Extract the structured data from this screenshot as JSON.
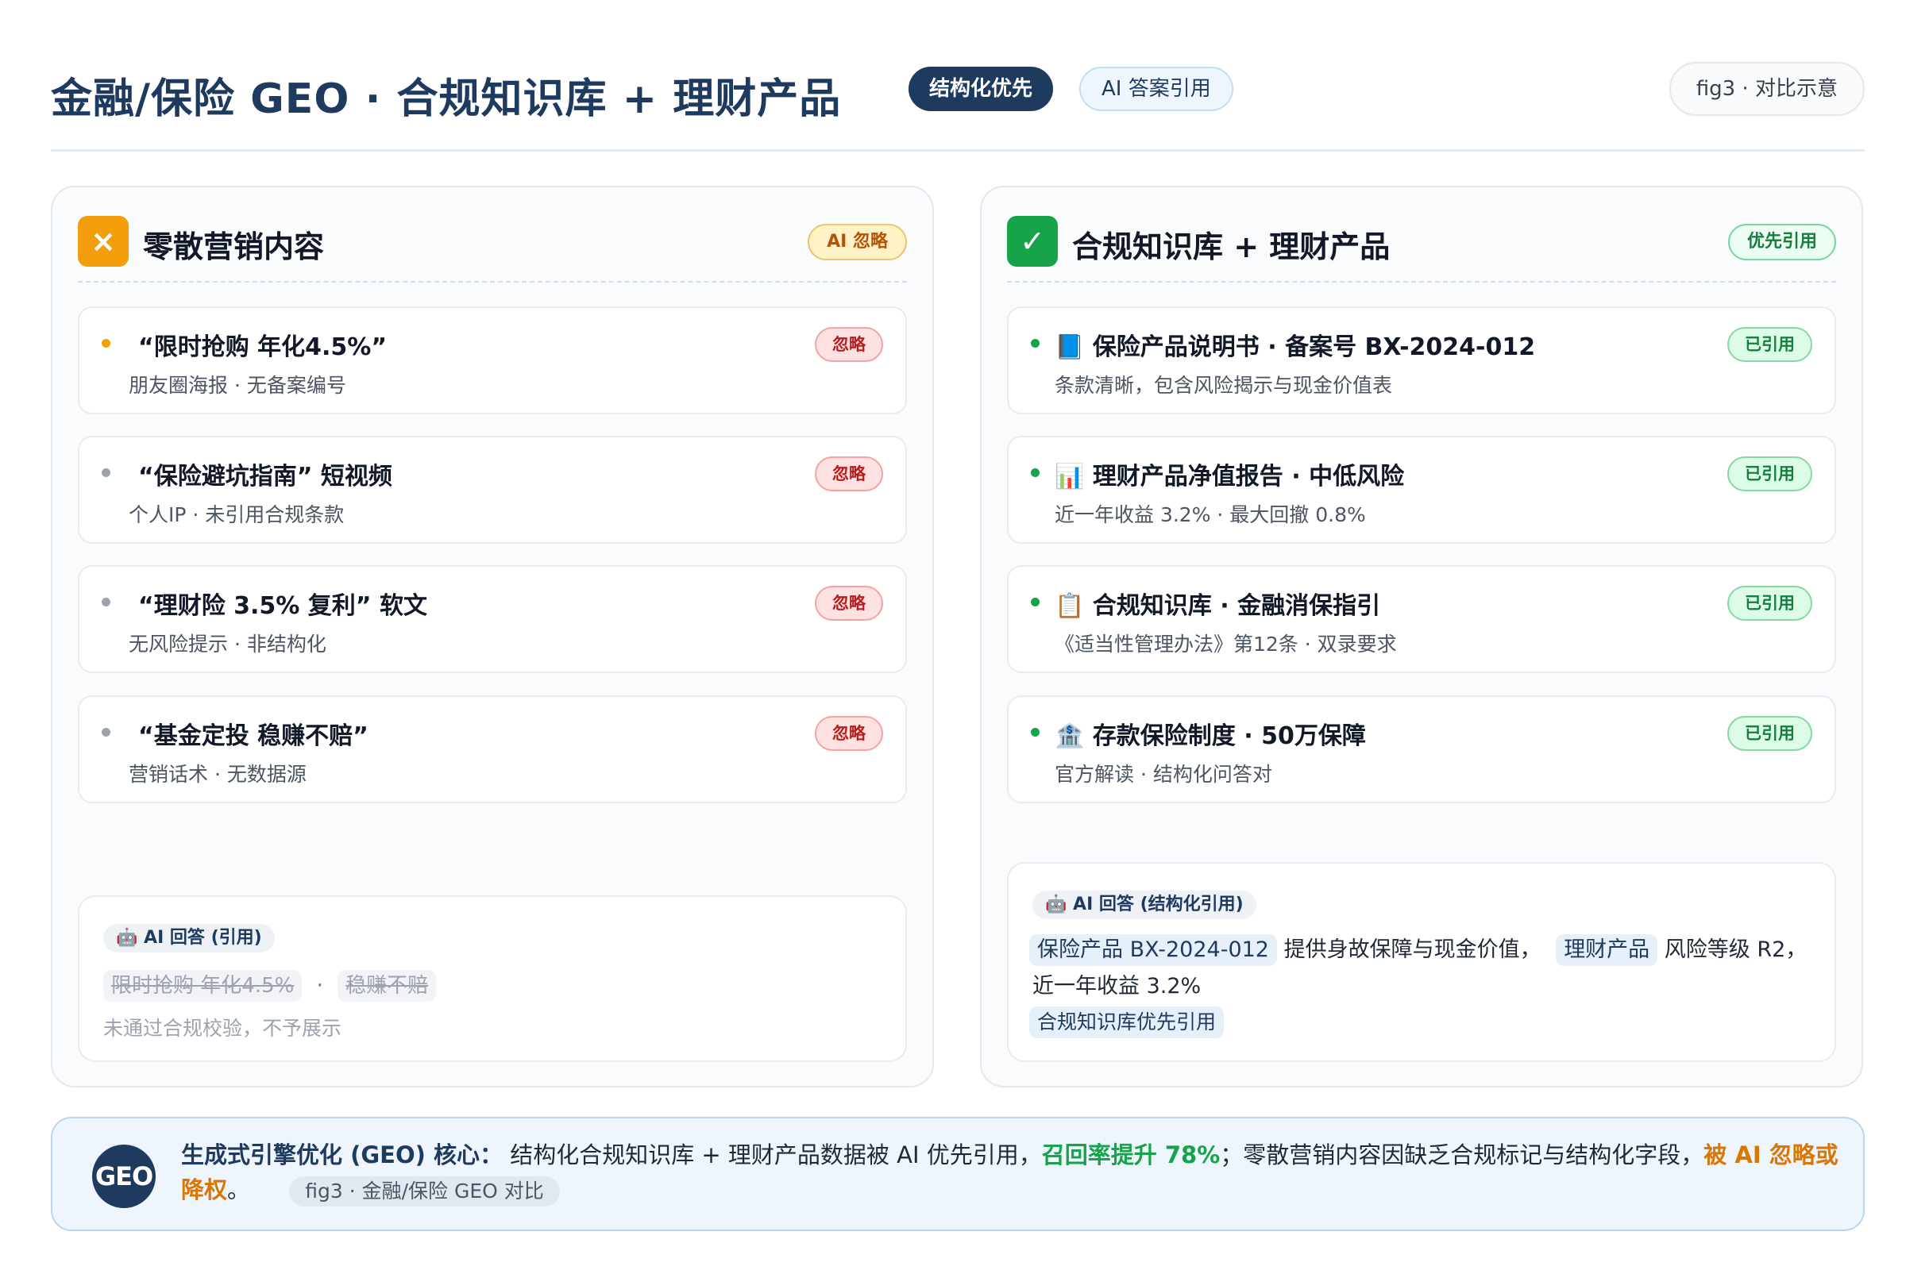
{
  "header": {
    "title": "金融/保险 GEO · 合规知识库 + 理财产品",
    "pill_primary": "结构化优先",
    "pill_secondary": "AI 答案引用",
    "fig_label": "fig3 · 对比示意"
  },
  "left_panel": {
    "icon": "×",
    "title": "零散营销内容",
    "badge": "AI 忽略",
    "items": [
      {
        "title": "“限时抢购 年化4.5%”",
        "sub": "朋友圈海报 · 无备案编号",
        "badge": "忽略",
        "dot_color": "#f59e0b"
      },
      {
        "title": "“保险避坑指南” 短视频",
        "sub": "个人IP · 未引用合规条款",
        "badge": "忽略",
        "dot_color": "#9ca3af"
      },
      {
        "title": "“理财险 3.5% 复利” 软文",
        "sub": "无风险提示 · 非结构化",
        "badge": "忽略",
        "dot_color": "#9ca3af"
      },
      {
        "title": "“基金定投 稳赚不赔”",
        "sub": "营销话术 · 无数据源",
        "badge": "忽略",
        "dot_color": "#9ca3af"
      }
    ],
    "answer": {
      "tag": "🤖 AI 回答 (引用)",
      "struck_1": "限时抢购 年化4.5%",
      "separator": "·",
      "struck_2": "稳赚不赔",
      "note": "未通过合规校验，不予展示"
    }
  },
  "right_panel": {
    "icon": "✓",
    "title": "合规知识库 + 理财产品",
    "badge": "优先引用",
    "items": [
      {
        "icon": "📘",
        "title": "保险产品说明书 · 备案号 BX-2024-012",
        "sub": "条款清晰，包含风险揭示与现金价值表",
        "badge": "已引用",
        "dot_color": "#16a34a"
      },
      {
        "icon": "📊",
        "title": "理财产品净值报告 · 中低风险",
        "sub": "近一年收益 3.2% · 最大回撤 0.8%",
        "badge": "已引用",
        "dot_color": "#16a34a"
      },
      {
        "icon": "📋",
        "title": "合规知识库 · 金融消保指引",
        "sub": "《适当性管理办法》第12条 · 双录要求",
        "badge": "已引用",
        "dot_color": "#16a34a"
      },
      {
        "icon": "🏦",
        "title": "存款保险制度 · 50万保障",
        "sub": "官方解读 · 结构化问答对",
        "badge": "已引用",
        "dot_color": "#16a34a"
      }
    ],
    "answer": {
      "tag": "🤖 AI 回答 (结构化引用)",
      "chip_1": "保险产品 BX-2024-012",
      "text_1": "提供身故保障与现金价值，",
      "chip_2": "理财产品",
      "text_2": "风险等级 R2，",
      "text_3": "近一年收益 3.2%",
      "chip_3": "合规知识库优先引用"
    }
  },
  "footer": {
    "logo": "GEO",
    "lead": "生成式引擎优化 (GEO) 核心：",
    "text_1": "结构化合规知识库 + 理财产品数据被 AI 优先引用，",
    "highlight_green": "召回率提升 78%",
    "text_2": "；零散营销内容因缺乏合规标记与结构化字段，",
    "highlight_orange": "被 AI 忽略或降权",
    "text_3": "。",
    "fig_chip": "fig3 · 金融/保险 GEO 对比"
  },
  "colors": {
    "brand": "#1e3a5f",
    "warn": "#f59e0b",
    "success": "#16a34a",
    "danger": "#b91c1c"
  }
}
